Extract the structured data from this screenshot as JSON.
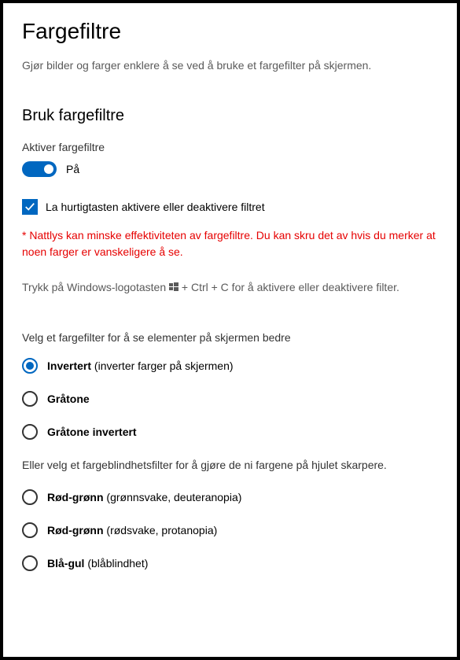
{
  "page": {
    "title": "Fargefiltre",
    "description": "Gjør bilder og farger enklere å se ved å bruke et fargefilter på skjermen."
  },
  "section": {
    "title": "Bruk fargefiltre",
    "toggle": {
      "label": "Aktiver fargefiltre",
      "state": "På",
      "on": true
    },
    "checkbox": {
      "label": "La hurtigtasten aktivere eller deaktivere filtret",
      "checked": true
    },
    "warning": {
      "star": "*",
      "link": "Nattlys",
      "rest": " kan minske effektiviteten av fargefiltre. Du kan skru det av hvis du merker at noen farger er vanskeligere å se."
    },
    "hint": {
      "before": "Trykk på Windows-logotasten ",
      "after": " + Ctrl + C for å aktivere eller deaktivere filter."
    }
  },
  "filters": {
    "label": "Velg et fargefilter for å se elementer på skjermen bedre",
    "options": [
      {
        "bold": "Invertert",
        "sub": " (inverter farger på skjermen)",
        "selected": true
      },
      {
        "bold": "Gråtone",
        "sub": "",
        "selected": false
      },
      {
        "bold": "Gråtone invertert",
        "sub": "",
        "selected": false
      }
    ]
  },
  "colorblind": {
    "description": "Eller velg et fargeblindhetsfilter for å gjøre de ni fargene på hjulet skarpere.",
    "options": [
      {
        "bold": "Rød-grønn",
        "sub": " (grønnsvake, deuteranopia)",
        "selected": false
      },
      {
        "bold": "Rød-grønn",
        "sub": " (rødsvake, protanopia)",
        "selected": false
      },
      {
        "bold": "Blå-gul",
        "sub": " (blåblindhet)",
        "selected": false
      }
    ]
  }
}
